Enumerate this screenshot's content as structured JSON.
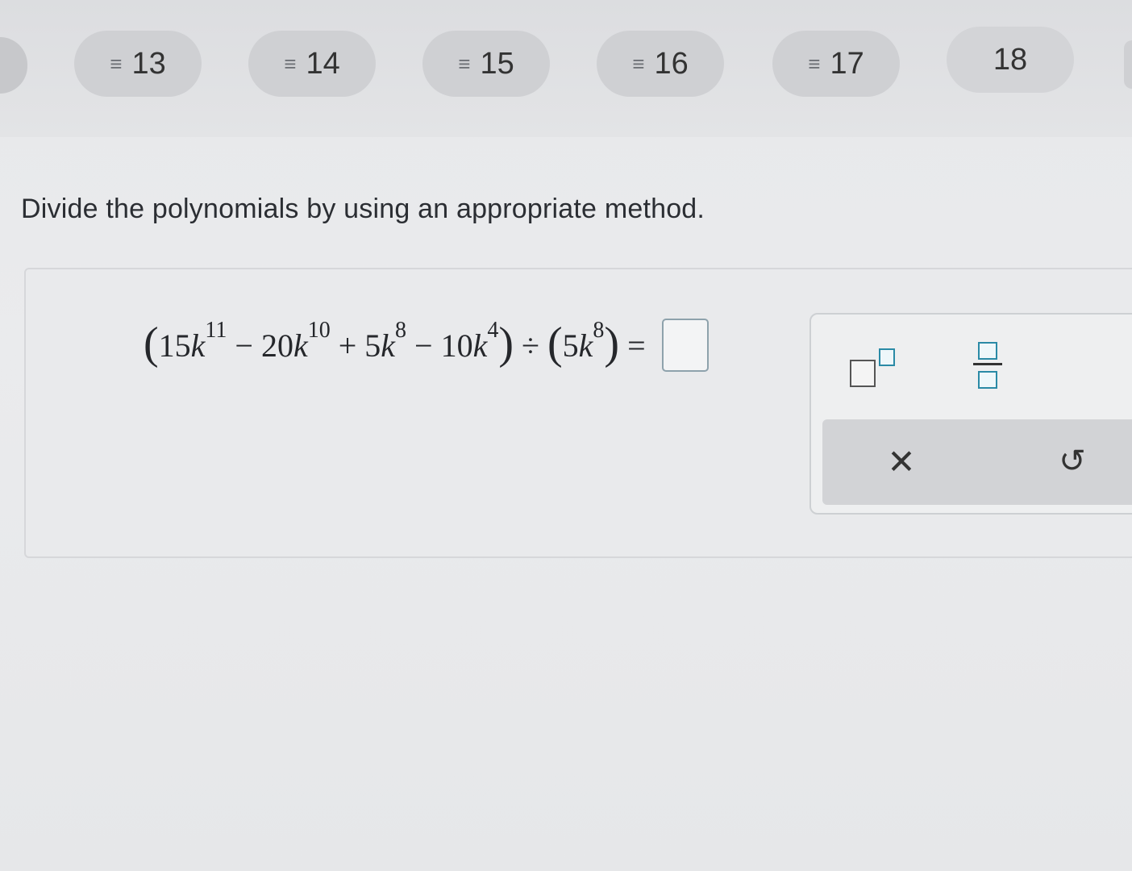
{
  "question_nav": [
    {
      "number": "13",
      "glyph": "≡"
    },
    {
      "number": "14",
      "glyph": "≡"
    },
    {
      "number": "15",
      "glyph": "≡"
    },
    {
      "number": "16",
      "glyph": "≡"
    },
    {
      "number": "17",
      "glyph": "≡"
    },
    {
      "number": "18",
      "glyph": ""
    }
  ],
  "prompt": "Divide the polynomials by using an appropriate method.",
  "expression": {
    "open": "(",
    "t1_coef": "15",
    "t1_var": "k",
    "t1_exp": "11",
    "minus1": "−",
    "t2_coef": "20",
    "t2_var": "k",
    "t2_exp": "10",
    "plus": "+",
    "t3_coef": "5",
    "t3_var": "k",
    "t3_exp": "8",
    "minus2": "−",
    "t4_coef": "10",
    "t4_var": "k",
    "t4_exp": "4",
    "close": ")",
    "divide": "÷",
    "open2": "(",
    "d_coef": "5",
    "d_var": "k",
    "d_exp": "8",
    "close2": ")",
    "equals": "="
  },
  "palette": {
    "clear_glyph": "✕",
    "undo_glyph": "↺"
  },
  "colors": {
    "accent": "#2a8aa6",
    "pill": "#cfd0d3"
  }
}
